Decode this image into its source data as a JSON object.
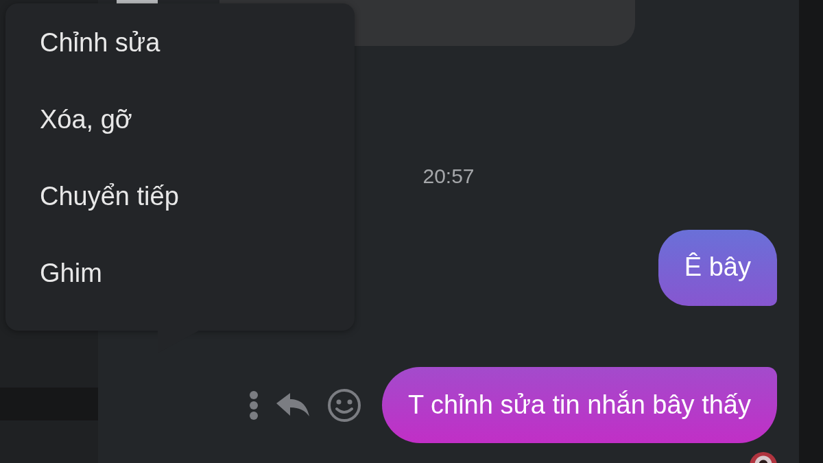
{
  "context_menu": {
    "items": [
      {
        "label": "Chỉnh sửa"
      },
      {
        "label": "Xóa, gỡ"
      },
      {
        "label": "Chuyển tiếp"
      },
      {
        "label": "Ghim"
      }
    ]
  },
  "timestamp": "20:57",
  "messages": [
    {
      "text": "Ê bây",
      "show_actions": false
    },
    {
      "text": "T chỉnh sửa tin nhắn bây thấy",
      "show_actions": true
    }
  ]
}
